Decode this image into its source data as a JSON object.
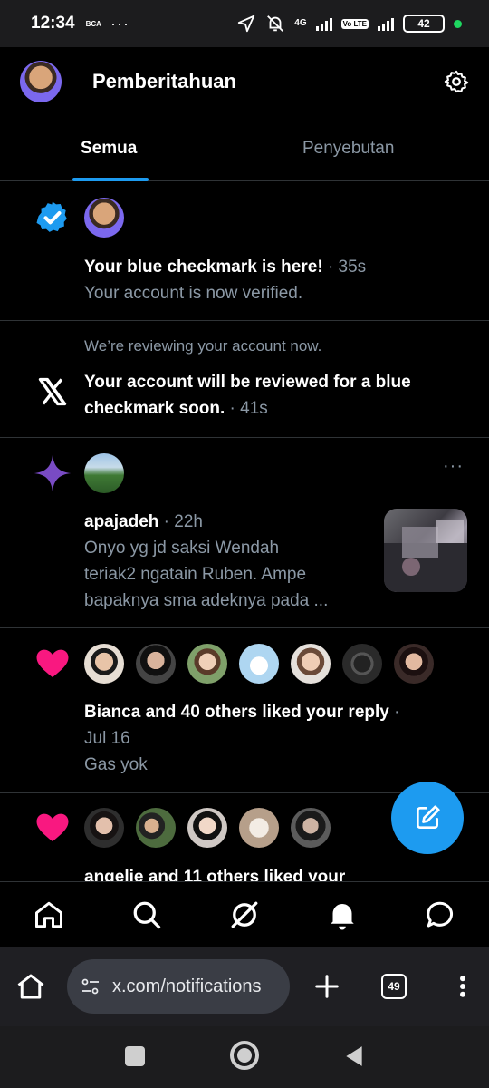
{
  "status_bar": {
    "time": "12:34",
    "carrier_mark": "BCA",
    "dots": "···",
    "net_tag": "4G",
    "volte": "Vo LTE",
    "battery": "42"
  },
  "header": {
    "title": "Pemberitahuan"
  },
  "tabs": [
    {
      "label": "Semua",
      "active": true
    },
    {
      "label": "Penyebutan",
      "active": false
    }
  ],
  "notifications": {
    "n1": {
      "icon": "verified-badge-icon",
      "title": "Your blue checkmark is here!",
      "time": "· 35s",
      "body": "Your account is now verified."
    },
    "n2": {
      "icon": "x-logo-icon",
      "pre": "We’re reviewing your account now.",
      "title_line1": "Your account will be reviewed for a blue",
      "title_line2": "checkmark soon.",
      "time": "· 41s"
    },
    "n3": {
      "icon": "sparkle-icon",
      "user": "apajadeh",
      "time": "· 22h",
      "line1": "Onyo yg jd saksi Wendah",
      "line2": "teriak2 ngatain Ruben. Ampe",
      "line3": "bapaknya sma adeknya pada ...",
      "more": "···"
    },
    "n4": {
      "icon": "heart-icon",
      "title": "Bianca and 40 others liked your reply",
      "dot": "·",
      "date": "Jul 16",
      "body": "Gas yok"
    },
    "n5": {
      "icon": "heart-icon",
      "title": "angelie and 11 others liked your"
    }
  },
  "browser": {
    "url": "x.com/notifications",
    "tab_count": "49"
  },
  "colors": {
    "accent": "#1d9bf0",
    "like": "#f91880",
    "sparkle": "#794bc4",
    "muted": "#8b98a5"
  }
}
